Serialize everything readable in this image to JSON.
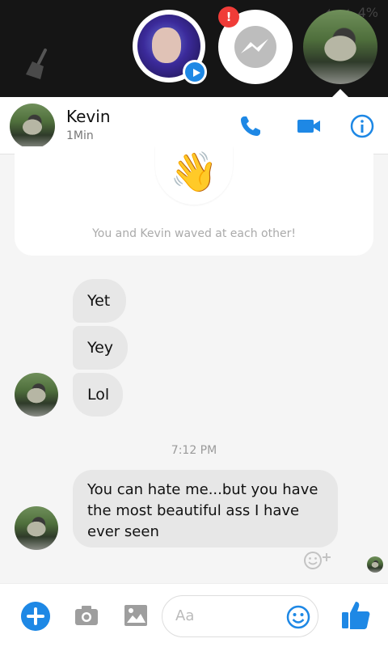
{
  "status_bar": {
    "icons": [
      "signal-icon",
      "wifi-icon",
      "battery-icon"
    ],
    "battery_text": "4%"
  },
  "chat_heads": {
    "alert_count": "!",
    "heads": [
      {
        "name": "chat-head-user"
      },
      {
        "name": "messenger-home"
      },
      {
        "name": "chat-head-kevin"
      }
    ]
  },
  "header": {
    "contact_name": "Kevin",
    "status": "1Min",
    "actions": [
      "phone-icon",
      "video-icon",
      "info-icon"
    ]
  },
  "conversation": {
    "wave_notice": "You and Kevin waved at each other!",
    "messages": [
      {
        "text": "Yet"
      },
      {
        "text": "Yey"
      },
      {
        "text": "Lol"
      }
    ],
    "timestamp": "7:12 PM",
    "long_message": "You can hate me...but you have the most beautiful ass I have ever seen"
  },
  "composer": {
    "placeholder": "Aa"
  },
  "colors": {
    "accent": "#1e88e5",
    "bubble_gray": "#e7e7e7",
    "alert_red": "#f03c38",
    "dark_bar": "#151515"
  }
}
